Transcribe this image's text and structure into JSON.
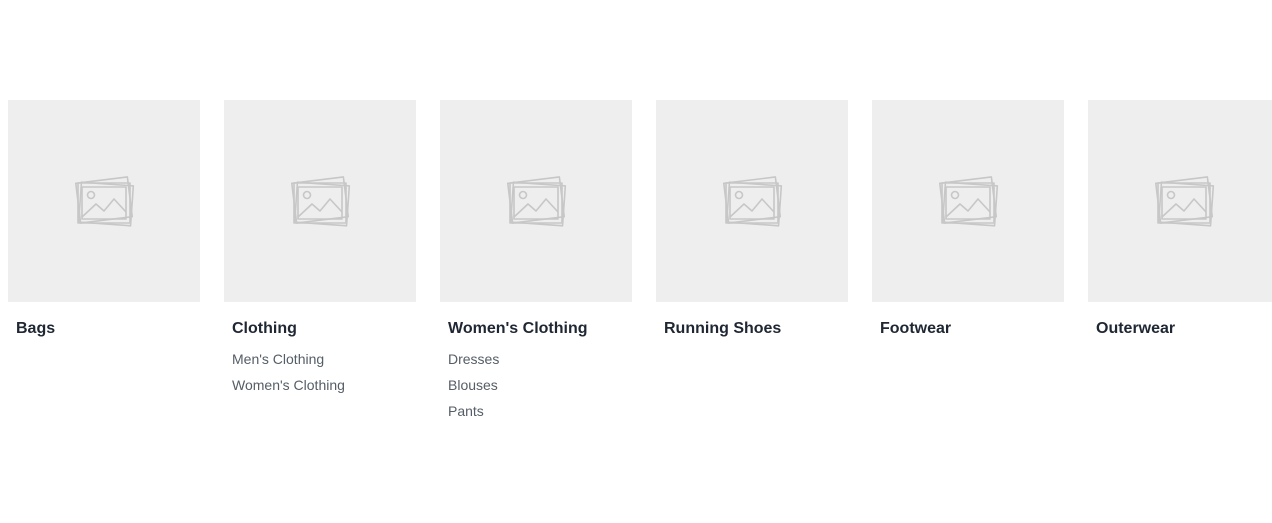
{
  "categories": [
    {
      "name": "Bags",
      "children": []
    },
    {
      "name": "Clothing",
      "children": [
        "Men's Clothing",
        "Women's Clothing"
      ]
    },
    {
      "name": "Women's Clothing",
      "children": [
        "Dresses",
        "Blouses",
        "Pants"
      ]
    },
    {
      "name": "Running Shoes",
      "children": []
    },
    {
      "name": "Footwear",
      "children": []
    },
    {
      "name": "Outerwear",
      "children": []
    }
  ],
  "colors": {
    "placeholder_bg": "#eeeeee",
    "placeholder_icon": "#c7c7c7",
    "title_text": "#1f2733",
    "subcategory_text": "#555d66"
  },
  "icons": {
    "thumbnail": "image-placeholder-icon"
  }
}
